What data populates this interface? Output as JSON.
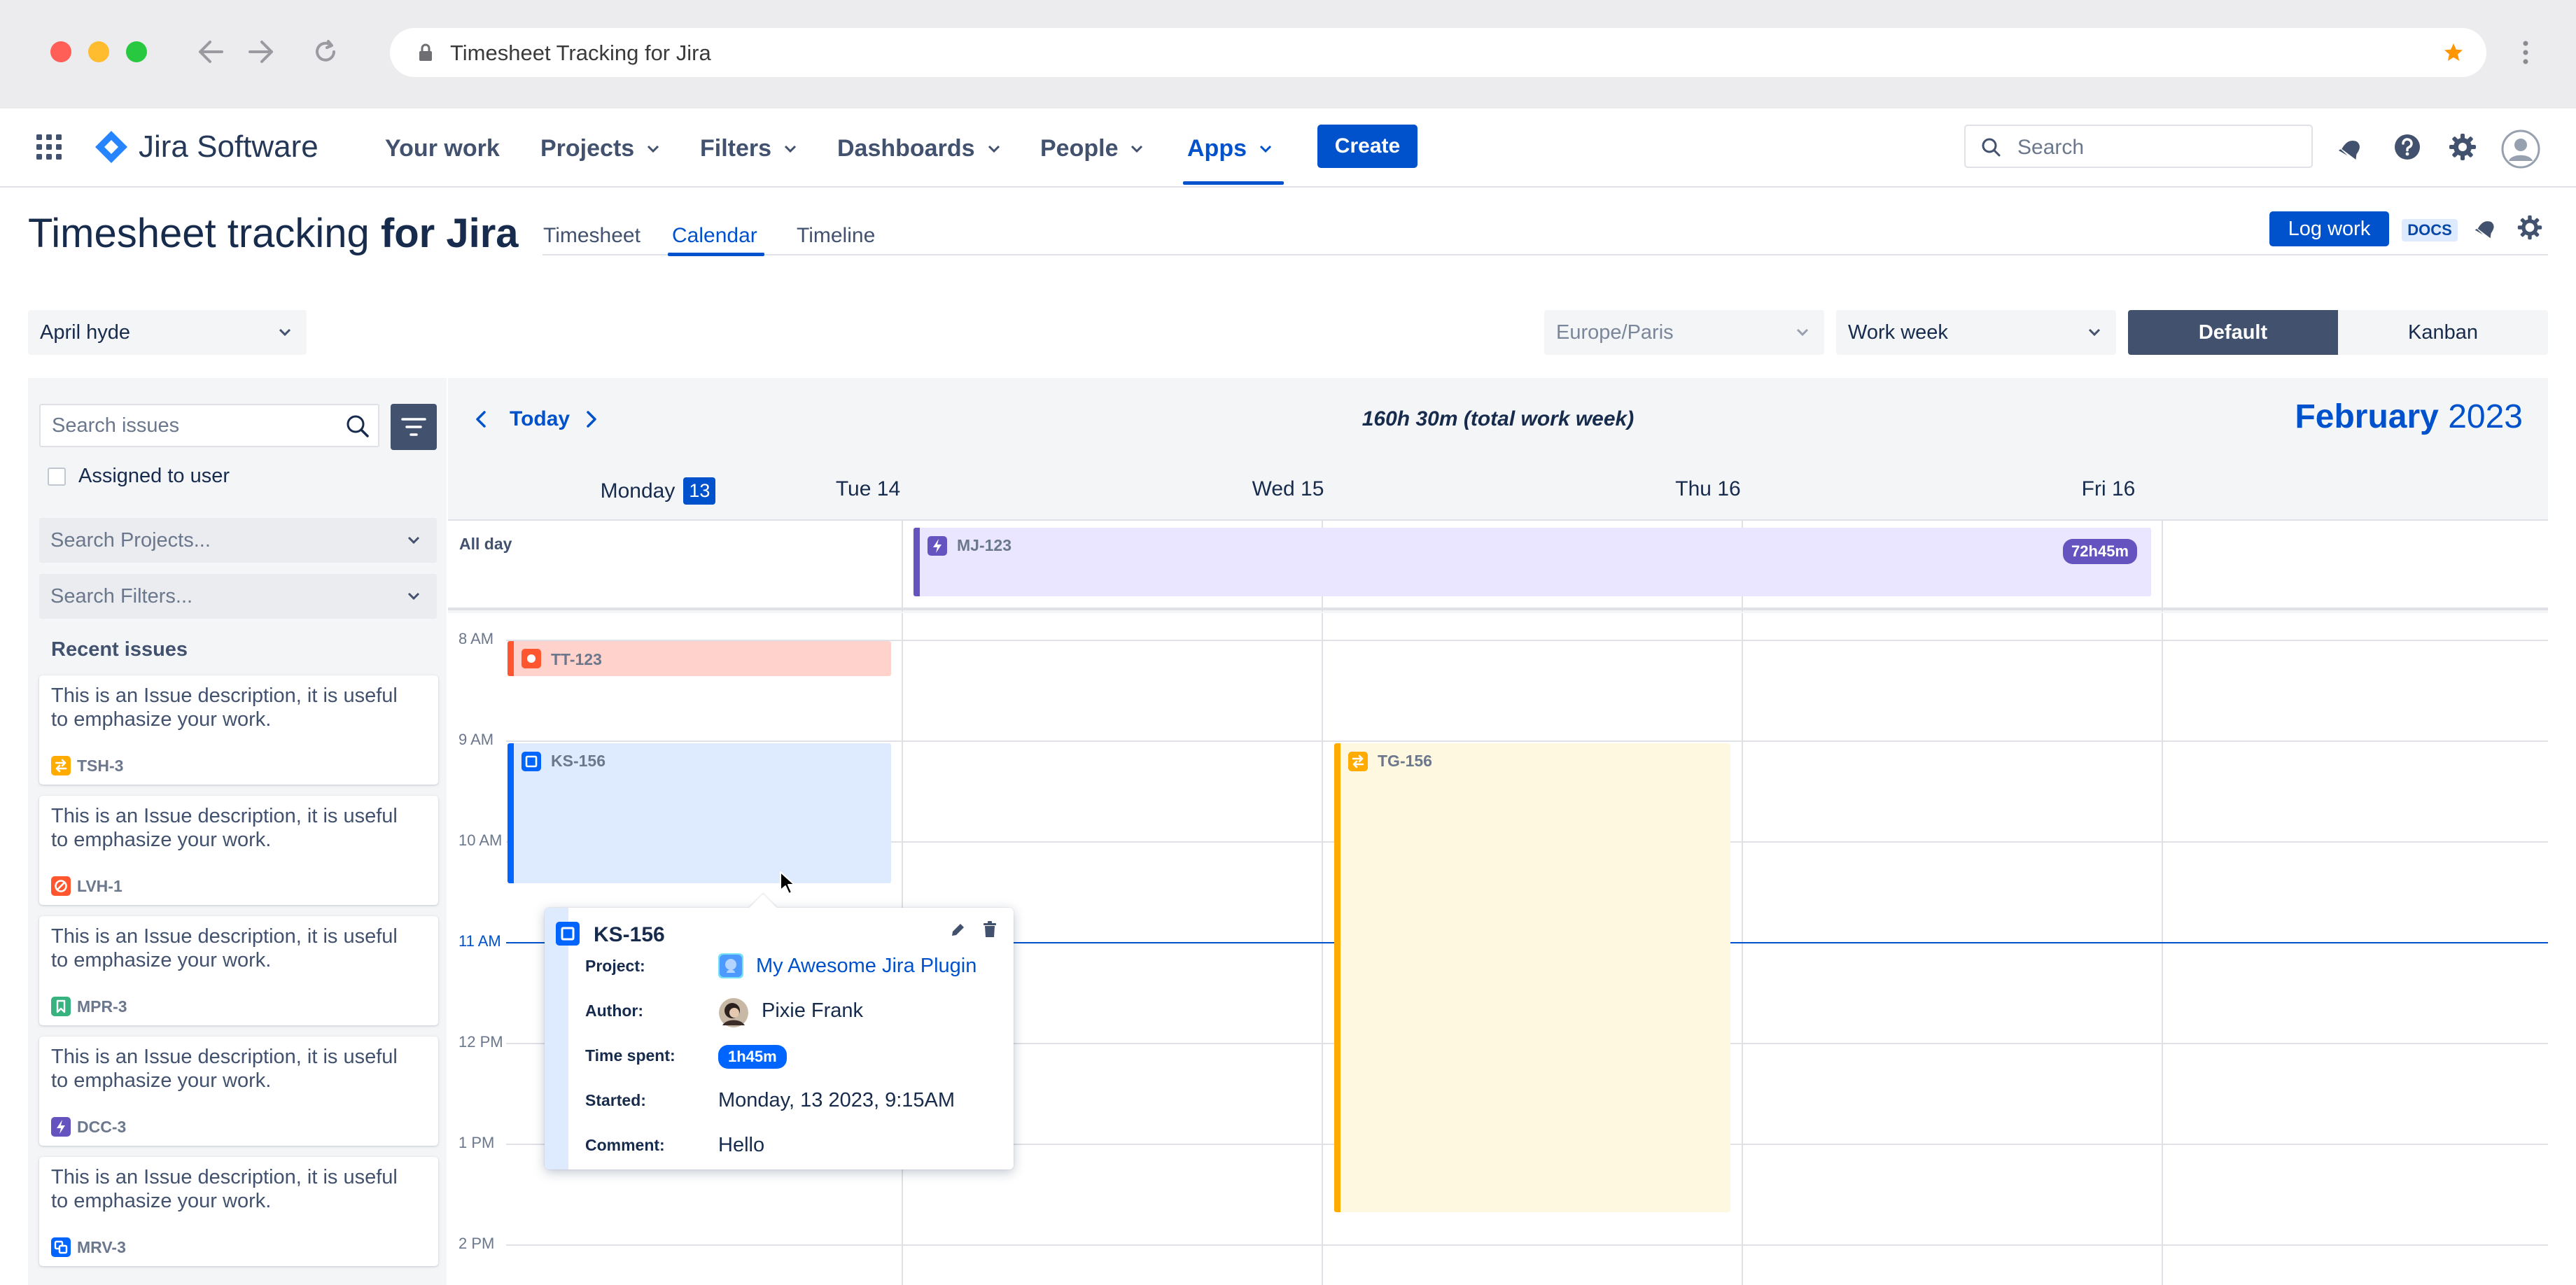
{
  "browser": {
    "url_title": "Timesheet Tracking for Jira"
  },
  "nav": {
    "product": "Jira Software",
    "your_work": "Your work",
    "projects": "Projects",
    "filters": "Filters",
    "dashboards": "Dashboards",
    "people": "People",
    "apps": "Apps",
    "create": "Create",
    "search_placeholder": "Search"
  },
  "header": {
    "title_regular": "Timesheet tracking ",
    "title_bold": "for Jira",
    "tabs": [
      "Timesheet",
      "Calendar",
      "Timeline"
    ],
    "active_tab": "Calendar",
    "log_work": "Log work",
    "docs": "DOCS"
  },
  "controls": {
    "user": "April hyde",
    "timezone": "Europe/Paris",
    "range": "Work week",
    "view_default": "Default",
    "view_kanban": "Kanban"
  },
  "sidebar": {
    "search_placeholder": "Search issues",
    "assigned_label": "Assigned to user",
    "projects_placeholder": "Search Projects...",
    "filters_placeholder": "Search Filters...",
    "recent_title": "Recent issues",
    "issues": [
      {
        "description": "This is an Issue description, it is useful to emphasize your work.",
        "key": "TSH-3",
        "color": "#FFAB00"
      },
      {
        "description": "This is an Issue description, it is useful to emphasize your work.",
        "key": "LVH-1",
        "color": "#FF5630"
      },
      {
        "description": "This is an Issue description, it is useful to emphasize your work.",
        "key": "MPR-3",
        "color": "#36B37E"
      },
      {
        "description": "This is an Issue description, it is useful to emphasize your work.",
        "key": "DCC-3",
        "color": "#6554C0"
      },
      {
        "description": "This is an Issue description, it is useful to emphasize your work.",
        "key": "MRV-3",
        "color": "#0065FF"
      }
    ]
  },
  "calendar": {
    "today": "Today",
    "total": "160h 30m (total work week)",
    "month": "February",
    "year": "2023",
    "days": [
      {
        "label": "Monday",
        "badge": "13"
      },
      {
        "label": "Tue 14"
      },
      {
        "label": "Wed 15"
      },
      {
        "label": "Thu 16"
      },
      {
        "label": "Fri 16"
      }
    ],
    "all_day": "All day",
    "times": [
      "8 AM",
      "9 AM",
      "10 AM",
      "11 AM",
      "12 PM",
      "1 PM",
      "2 PM"
    ],
    "events": {
      "mj": {
        "key": "MJ-123",
        "badge": "72h45m",
        "color": "#6554C0",
        "bg": "#EAE6FF"
      },
      "tt": {
        "key": "TT-123",
        "color": "#FF5630",
        "bg": "#FFD2CC"
      },
      "ks": {
        "key": "KS-156",
        "color": "#0065FF",
        "bg": "#DEEBFF"
      },
      "tg": {
        "key": "TG-156",
        "color": "#FFAB00",
        "bg": "#FFF8E1"
      }
    }
  },
  "popover": {
    "key": "KS-156",
    "project_label": "Project:",
    "project": "My Awesome Jira Plugin",
    "author_label": "Author:",
    "author": "Pixie Frank",
    "time_label": "Time spent:",
    "time": "1h45m",
    "started_label": "Started:",
    "started": "Monday, 13 2023, 9:15AM",
    "comment_label": "Comment:",
    "comment": "Hello"
  }
}
